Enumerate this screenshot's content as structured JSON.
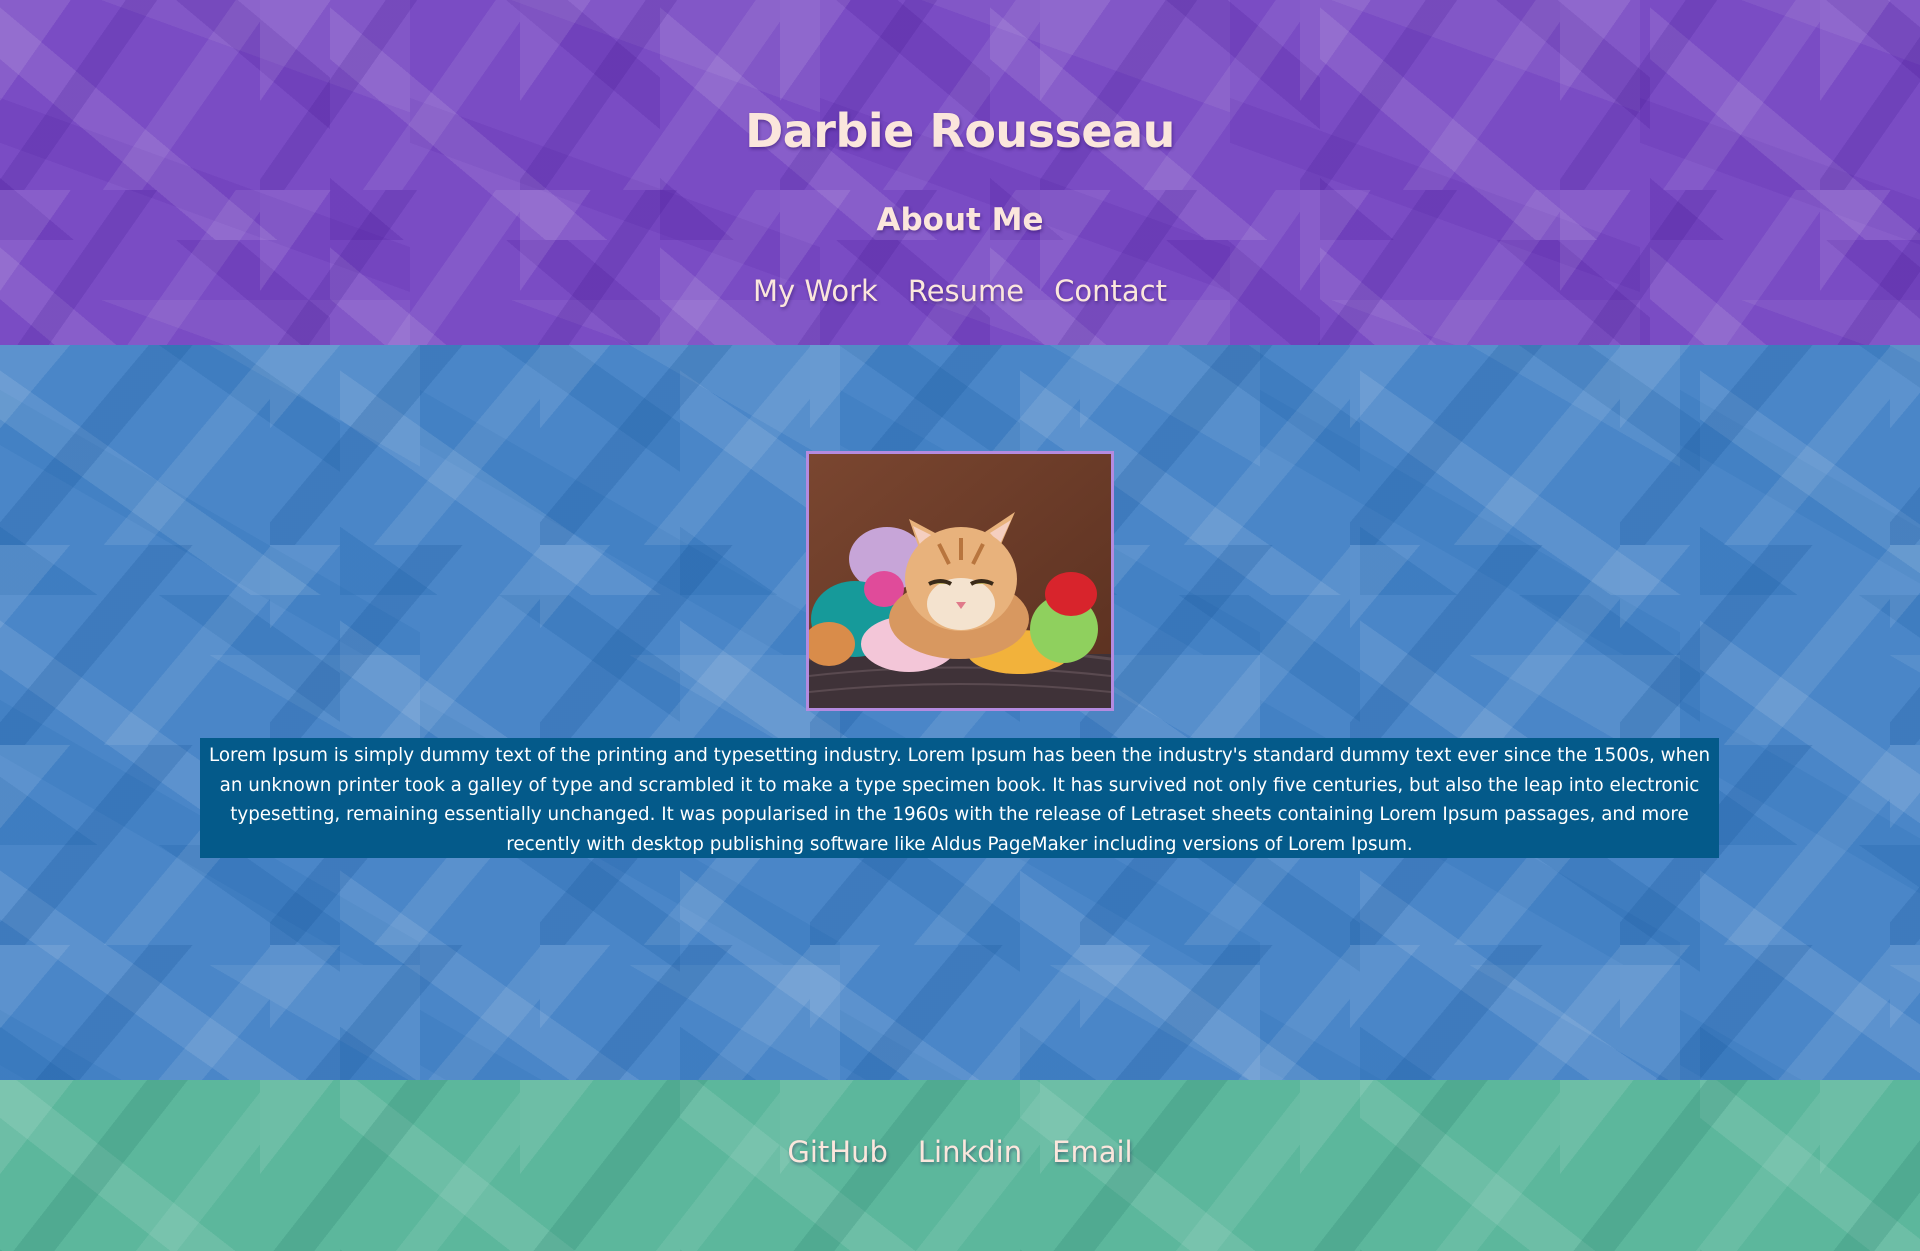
{
  "header": {
    "site_title": "Darbie Rousseau",
    "page_title": "About Me",
    "nav": [
      {
        "label": "My Work"
      },
      {
        "label": "Resume"
      },
      {
        "label": "Contact"
      }
    ]
  },
  "main": {
    "bio": "Lorem Ipsum is simply dummy text of the printing and typesetting industry. Lorem Ipsum has been the industry's standard dummy text ever since the 1500s, when an unknown printer took a galley of type and scrambled it to make a type specimen book. It has survived not only five centuries, but also the leap into electronic typesetting, remaining essentially unchanged. It was popularised in the 1960s with the release of Letraset sheets containing Lorem Ipsum passages, and more recently with desktop publishing software like Aldus PageMaker including versions of Lorem Ipsum."
  },
  "footer": {
    "links": [
      {
        "label": "GitHub"
      },
      {
        "label": "Linkdin"
      },
      {
        "label": "Email"
      }
    ]
  },
  "colors": {
    "header_bg": "#7a4cc4",
    "main_bg": "#4a86c8",
    "footer_bg": "#5cb79c",
    "bio_bg": "#045a8a",
    "heading_text": "#fbe6dc",
    "photo_border": "#b48be0"
  }
}
